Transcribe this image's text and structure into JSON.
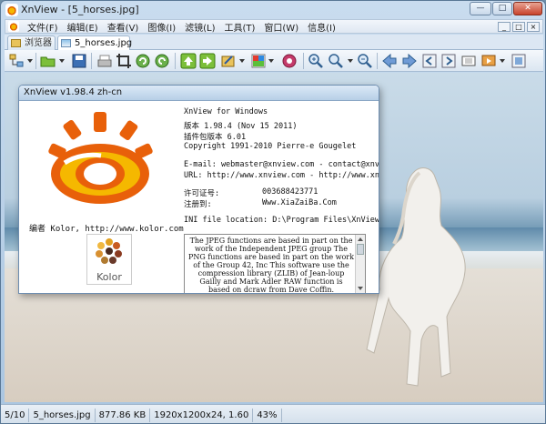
{
  "window": {
    "title": "XnView - [5_horses.jpg]",
    "min_glyph": "—",
    "max_glyph": "□",
    "close_glyph": "✕"
  },
  "menubar": {
    "items": [
      "文件(F)",
      "编辑(E)",
      "查看(V)",
      "图像(I)",
      "滤镜(L)",
      "工具(T)",
      "窗口(W)",
      "信息(I)"
    ],
    "mdi": [
      "_",
      "□",
      "×"
    ]
  },
  "tabs": [
    {
      "label": "浏览器"
    },
    {
      "label": "5_horses.jpg"
    }
  ],
  "about": {
    "title": "XnView v1.98.4 zh-cn",
    "product": "XnView for Windows",
    "version_line": "版本 1.98.4 (Nov 15 2011)",
    "plugin_line": "插件包版本 6.01",
    "copyright": "Copyright 1991-2010 Pierre-e Gougelet",
    "email": "E-mail: webmaster@xnview.com - contact@xnview.com",
    "url": "URL: http://www.xnview.com - http://www.xnview.org",
    "license_label": "许可证号:",
    "license_value": "003688423771",
    "registered_label": "注册到:",
    "registered_value": "Www.XiaZaiBa.Com",
    "ini_label": "INI file location: D:\\Program Files\\XnView\\x",
    "kolor_credit": "编者 Kolor, http://www.kolor.com",
    "kolor_logo_text": "Kolor",
    "credits": "The JPEG functions are based in part on the work of the Independent JPEG group The PNG functions are based in part on the work of the Group 42, Inc This software use the compression library (ZLIB) of Jean-loup Gailly and Mark Adler RAW function is based on dcraw from Dave Coffin."
  },
  "statusbar": {
    "position": "5/10",
    "filename": "5_horses.jpg",
    "filesize": "877.86 KB",
    "dimensions": "1920x1200x24, 1.60",
    "zoom": "43%"
  },
  "colors": {
    "logo_orange": "#e8600a",
    "logo_yellow": "#f5b800",
    "window_border": "#5a7896"
  }
}
